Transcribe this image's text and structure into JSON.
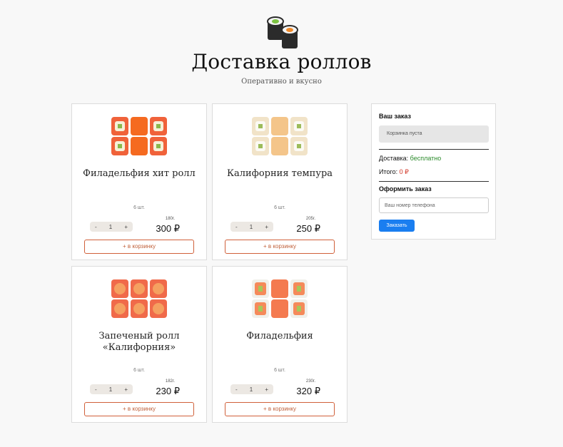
{
  "header": {
    "logo_icon": "sushi-rolls-icon",
    "title": "Доставка роллов",
    "subtitle": "Оперативно и вкусно"
  },
  "products": [
    {
      "name": "Филадельфия хит ролл",
      "count": "6 шт.",
      "quantity": "1",
      "weight": "180г.",
      "price": "300 ₽",
      "add_label": "+ в корзинку",
      "photo": "sushi-orange-icon"
    },
    {
      "name": "Калифорния темпура",
      "count": "6 шт.",
      "quantity": "1",
      "weight": "205г.",
      "price": "250 ₽",
      "add_label": "+ в корзинку",
      "photo": "sushi-tempura-icon"
    },
    {
      "name": "Запеченый ролл «Калифорния»",
      "count": "6 шт.",
      "quantity": "1",
      "weight": "182г.",
      "price": "230 ₽",
      "add_label": "+ в корзинку",
      "photo": "sushi-baked-icon"
    },
    {
      "name": "Филадельфия",
      "count": "6 шт.",
      "quantity": "1",
      "weight": "230г.",
      "price": "320 ₽",
      "add_label": "+ в корзинку",
      "photo": "sushi-salmon-icon"
    }
  ],
  "stepper": {
    "minus": "-",
    "plus": "+"
  },
  "order": {
    "title": "Ваш заказ",
    "empty_text": "Корзинка пуста",
    "delivery_label": "Доставка:",
    "delivery_value": "бесплатно",
    "total_label": "Итого:",
    "total_value": "0 ₽",
    "checkout_title": "Оформить заказ",
    "phone_placeholder": "Ваш номер телефона",
    "submit_label": "Заказать"
  },
  "colors": {
    "accent_button": "#1a7ef0",
    "add_button_border": "#d0603a",
    "delivery_free": "#2a8a2a",
    "total_value": "#d03020"
  }
}
